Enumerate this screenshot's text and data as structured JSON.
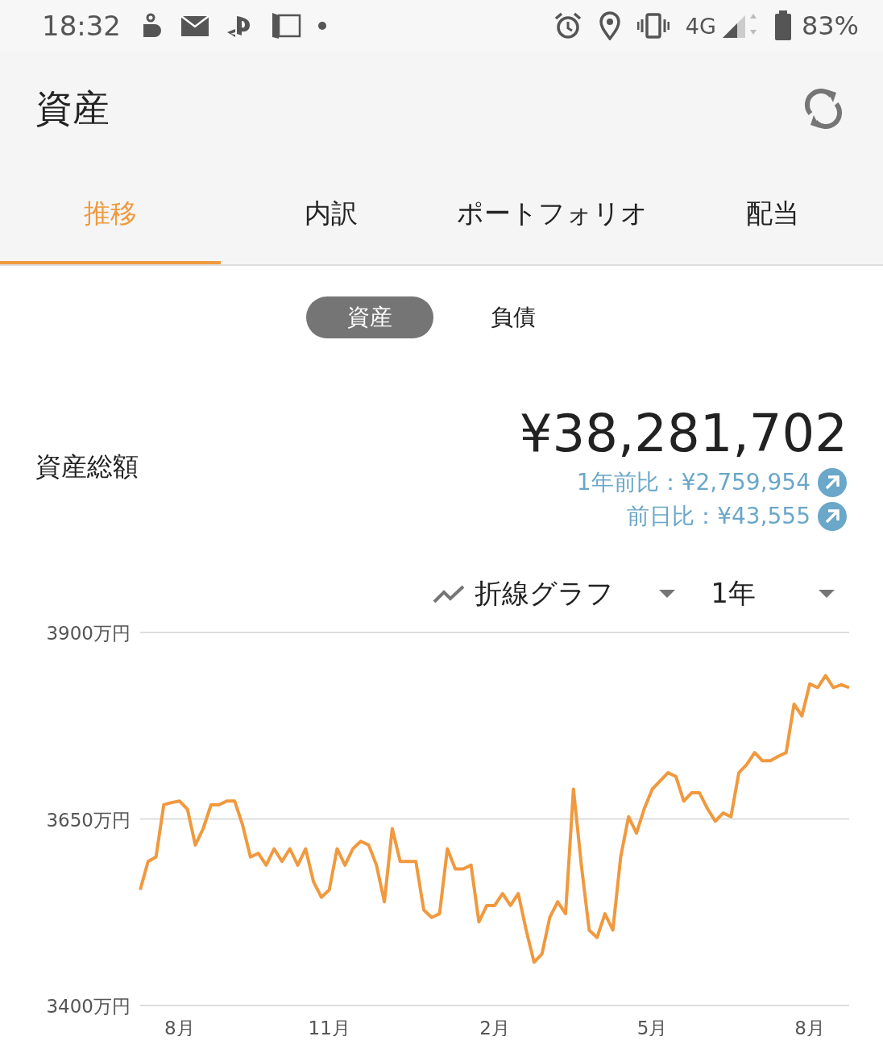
{
  "status_bar": {
    "time": "18:32",
    "network": "4G",
    "battery": "83%"
  },
  "header": {
    "title": "資産"
  },
  "tabs": [
    {
      "label": "推移",
      "selected": true
    },
    {
      "label": "内訳",
      "selected": false
    },
    {
      "label": "ポートフォリオ",
      "selected": false
    },
    {
      "label": "配当",
      "selected": false
    }
  ],
  "segments": [
    {
      "label": "資産",
      "selected": true
    },
    {
      "label": "負債",
      "selected": false
    }
  ],
  "summary": {
    "label": "資産総額",
    "amount": "¥38,281,702",
    "changes": [
      "1年前比：¥2,759,954",
      "前日比：¥43,555"
    ]
  },
  "controls": {
    "chart_type": "折線グラフ",
    "period": "1年"
  },
  "chart_data": {
    "type": "line",
    "categories": [
      null,
      null,
      null,
      null,
      null,
      "8月",
      null,
      null,
      null,
      null,
      null,
      null,
      null,
      null,
      null,
      null,
      null,
      null,
      null,
      null,
      null,
      null,
      null,
      null,
      "11月",
      null,
      null,
      null,
      null,
      null,
      null,
      null,
      null,
      null,
      null,
      null,
      null,
      null,
      null,
      null,
      null,
      null,
      null,
      null,
      null,
      "2月",
      null,
      null,
      null,
      null,
      null,
      null,
      null,
      null,
      null,
      null,
      null,
      null,
      null,
      null,
      null,
      null,
      null,
      null,
      null,
      "5月",
      null,
      null,
      null,
      null,
      null,
      null,
      null,
      null,
      null,
      null,
      null,
      null,
      null,
      null,
      null,
      null,
      null,
      null,
      null,
      "8月",
      null,
      null,
      null,
      null,
      null
    ],
    "series": [
      {
        "color": "#f0993e",
        "values": [
          3555,
          3593,
          3599,
          3669,
          3672,
          3674,
          3663,
          3615,
          3637,
          3669,
          3669,
          3674,
          3674,
          3642,
          3599,
          3604,
          3588,
          3610,
          3593,
          3610,
          3588,
          3610,
          3566,
          3545,
          3555,
          3610,
          3588,
          3610,
          3620,
          3615,
          3588,
          3539,
          3637,
          3593,
          3593,
          3593,
          3528,
          3518,
          3523,
          3610,
          3583,
          3583,
          3588,
          3512,
          3534,
          3534,
          3550,
          3534,
          3550,
          3501,
          3458,
          3469,
          3518,
          3539,
          3523,
          3690,
          3588,
          3501,
          3491,
          3523,
          3501,
          3599,
          3653,
          3631,
          3664,
          3690,
          3701,
          3712,
          3707,
          3674,
          3685,
          3685,
          3664,
          3647,
          3658,
          3653,
          3712,
          3723,
          3739,
          3728,
          3728,
          3734,
          3739,
          3804,
          3788,
          3831,
          3826,
          3842,
          3826,
          3830,
          3826
        ]
      }
    ],
    "ylim": [
      3400,
      3900
    ],
    "yticks": [
      {
        "value": 3900,
        "label": "3900万円"
      },
      {
        "value": 3650,
        "label": "3650万円"
      },
      {
        "value": 3400,
        "label": "3400万円"
      }
    ]
  }
}
